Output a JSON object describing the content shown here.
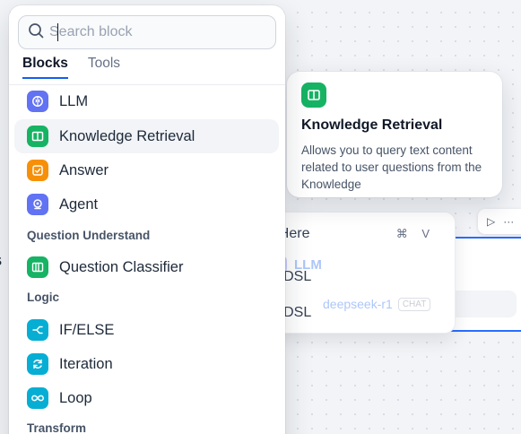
{
  "search": {
    "placeholder": "Search block",
    "value": ""
  },
  "tabs": [
    {
      "label": "Blocks",
      "active": true
    },
    {
      "label": "Tools",
      "active": false
    }
  ],
  "blocks": {
    "llm": {
      "label": "LLM",
      "icon": "brain-icon",
      "color": "#6172f3"
    },
    "knowledge_retrieval": {
      "label": "Knowledge Retrieval",
      "icon": "book-icon",
      "color": "#16b364"
    },
    "answer": {
      "label": "Answer",
      "icon": "answer-icon",
      "color": "#f79009"
    },
    "agent": {
      "label": "Agent",
      "icon": "agent-icon",
      "color": "#6172f3"
    }
  },
  "groups": {
    "question_understand": {
      "title": "Question Understand",
      "items": [
        {
          "label": "Question Classifier",
          "icon": "classifier-icon",
          "color": "#16b364"
        }
      ]
    },
    "logic": {
      "title": "Logic",
      "items": [
        {
          "label": "IF/ELSE",
          "icon": "branch-icon",
          "color": "#06aed4"
        },
        {
          "label": "Iteration",
          "icon": "iteration-icon",
          "color": "#06aed4"
        },
        {
          "label": "Loop",
          "icon": "loop-icon",
          "color": "#06aed4"
        }
      ]
    },
    "transform": {
      "title": "Transform"
    }
  },
  "tooltip": {
    "title": "Knowledge Retrieval",
    "description": "Allows you to query text content related to user questions from the Knowledge",
    "icon": "book-icon",
    "color": "#16b364"
  },
  "background": {
    "node_start_fragment": "S",
    "context_menu": {
      "items": [
        {
          "label": "te Here",
          "shortcut": "⌘ V"
        },
        {
          "label": "ort DSL"
        },
        {
          "label": "ort DSL"
        }
      ]
    },
    "llm_node": {
      "title": "LLM",
      "model": "deepseek-r1",
      "model_tag": "CHAT",
      "accent": "#296dff"
    },
    "toolbar": {
      "play": "▷",
      "more": "···"
    }
  }
}
